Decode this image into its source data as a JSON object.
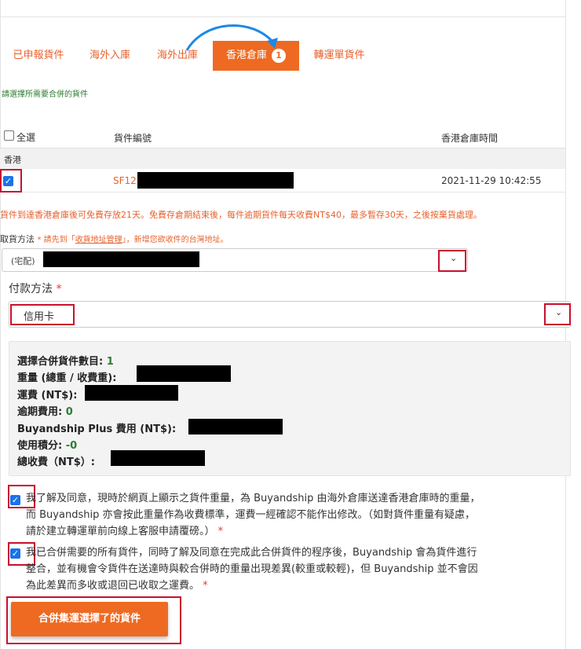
{
  "tabs": [
    {
      "label": "已申報貨件"
    },
    {
      "label": "海外入庫"
    },
    {
      "label": "海外出庫"
    },
    {
      "label": "香港倉庫",
      "badge": "1"
    },
    {
      "label": "轉運單貨件"
    }
  ],
  "hint": "請選擇所需要合併的貨件",
  "table": {
    "select_all": "全選",
    "col_id": "貨件編號",
    "col_time": "香港倉庫時間",
    "group": "香港",
    "rows": [
      {
        "id": "SF12",
        "time": "2021-11-29 10:42:55"
      }
    ]
  },
  "storage_notice": "貨件到達香港倉庫後可免費存放21天。免費存倉期結束後，每件逾期貨件每天收費NT$40，最多暫存30天，之後按棄貨處理。",
  "pickup": {
    "label": "取貨方法",
    "note_prefix": "* 請先到「",
    "note_link": "收貨地址管理",
    "note_suffix": "」，新增您欲收件的台灣地址。",
    "selected_prefix": "(宅配)"
  },
  "payment": {
    "label": "付款方法",
    "required": "*",
    "selected": "信用卡"
  },
  "summary": {
    "count_label": "選擇合併貨件數目:",
    "count_value": "1",
    "weight_label": "重量 (總重 / 收費重):",
    "freight_label": "運費 (NT$):",
    "overdue_label": "逾期費用:",
    "overdue_value": "0",
    "plus_label": "Buyandship Plus 費用 (NT$):",
    "points_label": "使用積分:",
    "points_value": "-0",
    "total_label": "總收費（NT$）:"
  },
  "agreements": [
    {
      "lines": [
        "我了解及同意，現時於網頁上顯示之貨件重量，為 Buyandship 由海外倉庫送達香港倉庫時的重量，",
        "而 Buyandship 亦會按此重量作為收費標準，運費一經確認不能作出修改。（如對貨件重量有疑慮，",
        "請於建立轉運單前向線上客服申請覆磅。）"
      ],
      "required": "*"
    },
    {
      "lines": [
        "我已合併需要的所有貨件，同時了解及同意在完成此合併貨件的程序後，Buyandship 會為貨件進行",
        "整合，並有機會令貨件在送達時與較合併時的重量出現差異(較重或較輕)，但 Buyandship 並不會因",
        "為此差異而多收或退回已收取之運費。"
      ],
      "required": "*"
    }
  ],
  "submit_label": "合併集運選擇了的貨件",
  "colors": {
    "accent": "#ee6a22",
    "highlight": "#c8102e",
    "check": "#1a73e8",
    "positive": "#2e7d32"
  }
}
